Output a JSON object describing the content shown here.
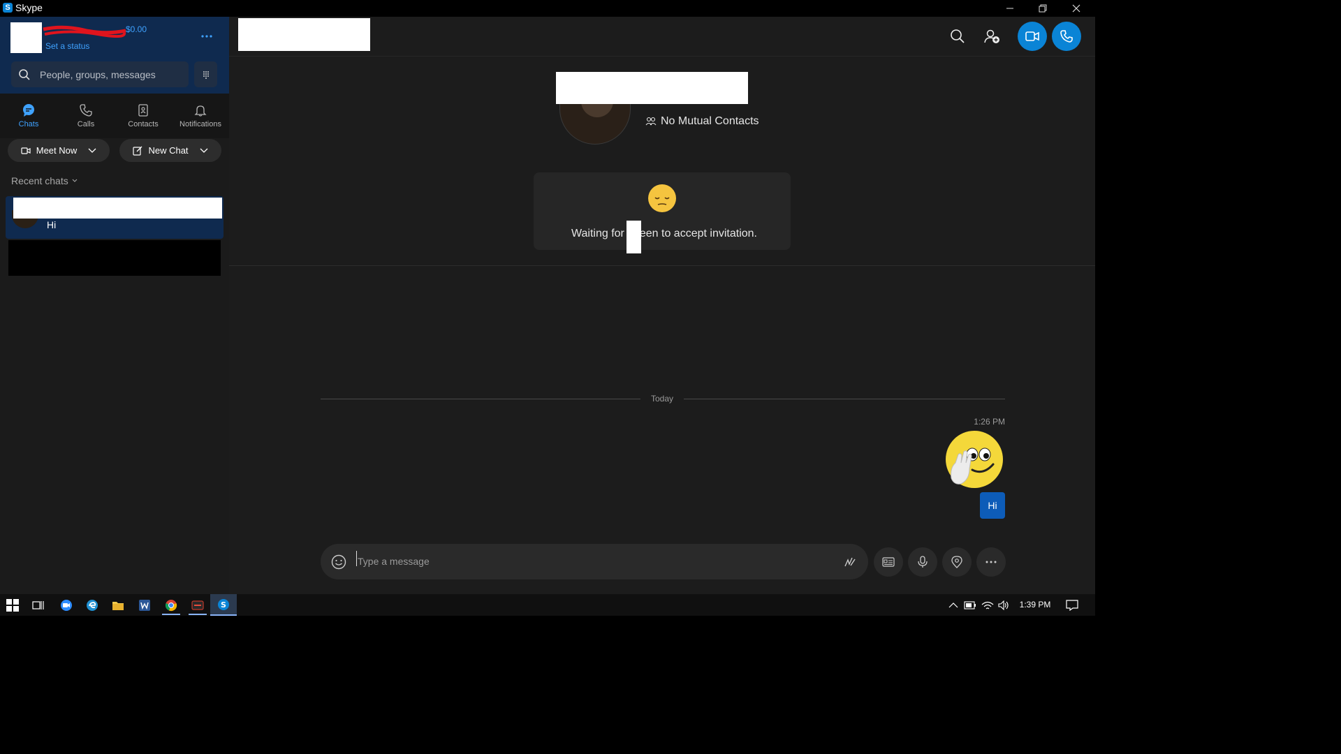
{
  "window": {
    "title": "Skype"
  },
  "profile": {
    "balance": "$0.00",
    "status_link": "Set a status"
  },
  "search": {
    "placeholder": "People, groups, messages"
  },
  "tabs": [
    {
      "label": "Chats"
    },
    {
      "label": "Calls"
    },
    {
      "label": "Contacts"
    },
    {
      "label": "Notifications"
    }
  ],
  "actions": {
    "meet_now": "Meet Now",
    "new_chat": "New Chat"
  },
  "recent": {
    "header": "Recent chats",
    "items": [
      {
        "preview": "Hi"
      }
    ]
  },
  "contact_card": {
    "mutual": "No Mutual Contacts"
  },
  "invite": {
    "text_before": "Waiting for",
    "text_after": "een to accept invitation."
  },
  "conversation": {
    "divider": "Today",
    "messages": [
      {
        "time": "1:26 PM",
        "sticker": "hand-wave-emoji",
        "text": "Hi"
      }
    ]
  },
  "composer": {
    "placeholder": "Type a message"
  },
  "taskbar": {
    "time": "1:39 PM"
  },
  "colors": {
    "accent": "#0a84d6",
    "sidebar_top": "#0f2a4f",
    "bubble": "#0d5cb8",
    "background": "#1c1c1c"
  }
}
